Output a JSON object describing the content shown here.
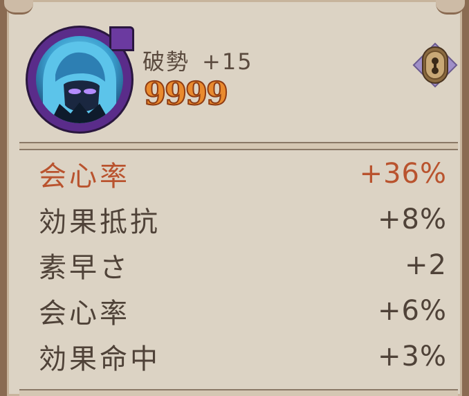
{
  "soul": {
    "name": "破勢",
    "level": "+15",
    "power": "9999",
    "lock_icon": "lock-icon"
  },
  "stats": [
    {
      "name": "会心率",
      "value": "+36%",
      "main": true
    },
    {
      "name": "効果抵抗",
      "value": "+8%",
      "main": false
    },
    {
      "name": "素早さ",
      "value": "+2",
      "main": false
    },
    {
      "name": "会心率",
      "value": "+6%",
      "main": false
    },
    {
      "name": "効果命中",
      "value": "+3%",
      "main": false
    }
  ],
  "colors": {
    "main_stat": "#b9532e",
    "sub_stat": "#4f4238",
    "power": "#e98a2e",
    "frame": "#5a2c8a"
  }
}
